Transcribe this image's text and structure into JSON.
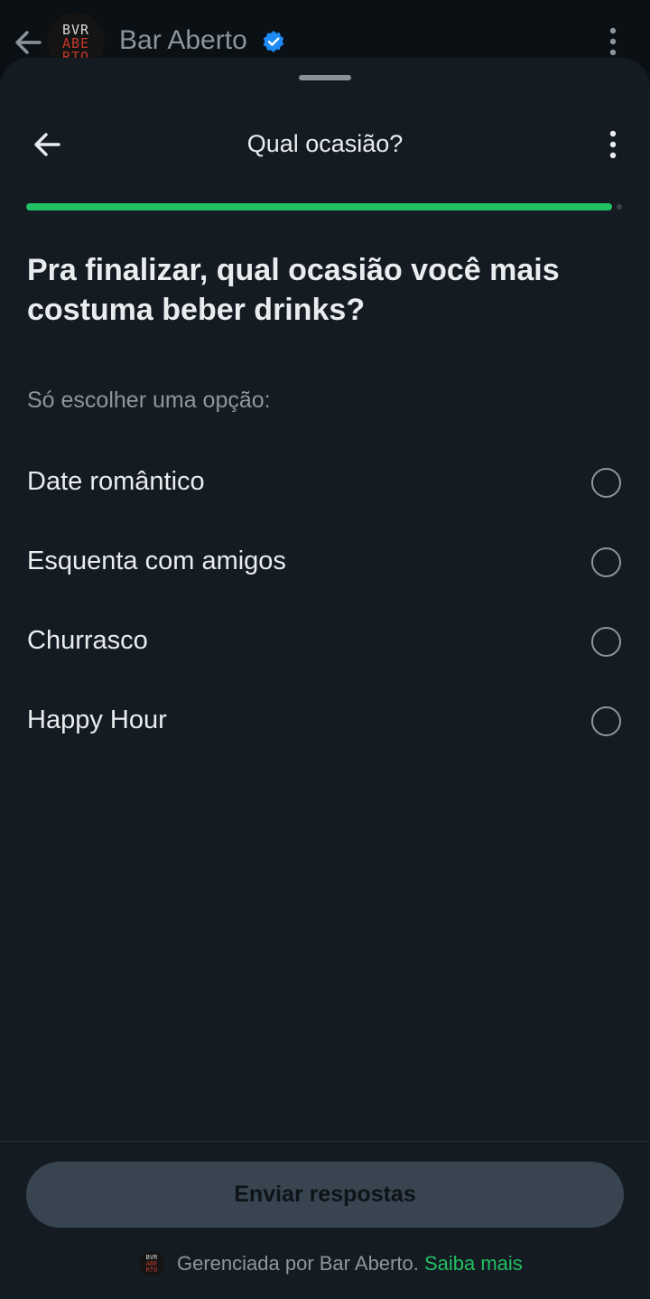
{
  "chat_header": {
    "back_icon": "arrow-left-icon",
    "avatar": {
      "line1": "BVR",
      "line2": "ABE",
      "line3": "RTO"
    },
    "name": "Bar Aberto",
    "verified_icon": "verified-badge-icon",
    "more_icon": "more-vertical-icon"
  },
  "sheet": {
    "back_icon": "arrow-left-icon",
    "title": "Qual ocasião?",
    "more_icon": "more-vertical-icon",
    "progress": 0.98,
    "question": "Pra finalizar, qual ocasião você mais costuma beber drinks?",
    "hint": "Só escolher uma opção:",
    "options": [
      {
        "label": "Date romântico",
        "selected": false
      },
      {
        "label": "Esquenta com amigos",
        "selected": false
      },
      {
        "label": "Churrasco",
        "selected": false
      },
      {
        "label": "Happy Hour",
        "selected": false
      }
    ],
    "submit_label": "Enviar respostas",
    "footer": {
      "managed_by": "Gerenciada por Bar Aberto.",
      "learn_more": "Saiba mais"
    }
  },
  "colors": {
    "accent_green": "#21c063",
    "sheet_bg": "#151b22",
    "verified_blue": "#1d8af5"
  }
}
